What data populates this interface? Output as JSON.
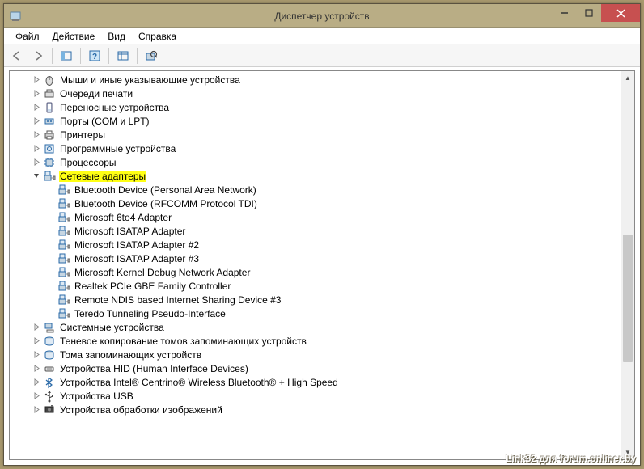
{
  "window": {
    "title": "Диспетчер устройств"
  },
  "menu": {
    "file": "Файл",
    "action": "Действие",
    "view": "Вид",
    "help": "Справка"
  },
  "tree": {
    "items": [
      {
        "indent": 1,
        "exp": "collapsed",
        "icon": "mouse",
        "label": "Мыши и иные указывающие устройства"
      },
      {
        "indent": 1,
        "exp": "collapsed",
        "icon": "printq",
        "label": "Очереди печати"
      },
      {
        "indent": 1,
        "exp": "collapsed",
        "icon": "portable",
        "label": "Переносные устройства"
      },
      {
        "indent": 1,
        "exp": "collapsed",
        "icon": "port",
        "label": "Порты (COM и LPT)"
      },
      {
        "indent": 1,
        "exp": "collapsed",
        "icon": "printer",
        "label": "Принтеры"
      },
      {
        "indent": 1,
        "exp": "collapsed",
        "icon": "software",
        "label": "Программные устройства"
      },
      {
        "indent": 1,
        "exp": "collapsed",
        "icon": "cpu",
        "label": "Процессоры"
      },
      {
        "indent": 1,
        "exp": "expanded",
        "icon": "net",
        "label": "Сетевые адаптеры",
        "highlight": true
      },
      {
        "indent": 2,
        "exp": "none",
        "icon": "net",
        "label": "Bluetooth Device (Personal Area Network)"
      },
      {
        "indent": 2,
        "exp": "none",
        "icon": "net",
        "label": "Bluetooth Device (RFCOMM Protocol TDI)"
      },
      {
        "indent": 2,
        "exp": "none",
        "icon": "net",
        "label": "Microsoft 6to4 Adapter"
      },
      {
        "indent": 2,
        "exp": "none",
        "icon": "net",
        "label": "Microsoft ISATAP Adapter"
      },
      {
        "indent": 2,
        "exp": "none",
        "icon": "net",
        "label": "Microsoft ISATAP Adapter #2"
      },
      {
        "indent": 2,
        "exp": "none",
        "icon": "net",
        "label": "Microsoft ISATAP Adapter #3"
      },
      {
        "indent": 2,
        "exp": "none",
        "icon": "net",
        "label": "Microsoft Kernel Debug Network Adapter"
      },
      {
        "indent": 2,
        "exp": "none",
        "icon": "net",
        "label": "Realtek PCIe GBE Family Controller"
      },
      {
        "indent": 2,
        "exp": "none",
        "icon": "net",
        "label": "Remote NDIS based Internet Sharing Device #3"
      },
      {
        "indent": 2,
        "exp": "none",
        "icon": "net",
        "label": "Teredo Tunneling Pseudo-Interface"
      },
      {
        "indent": 1,
        "exp": "collapsed",
        "icon": "system",
        "label": "Системные устройства"
      },
      {
        "indent": 1,
        "exp": "collapsed",
        "icon": "shadow",
        "label": "Теневое копирование томов запоминающих устройств"
      },
      {
        "indent": 1,
        "exp": "collapsed",
        "icon": "shadow",
        "label": "Тома запоминающих устройств"
      },
      {
        "indent": 1,
        "exp": "collapsed",
        "icon": "hid",
        "label": "Устройства HID (Human Interface Devices)"
      },
      {
        "indent": 1,
        "exp": "collapsed",
        "icon": "bt",
        "label": "Устройства Intel® Centrino® Wireless Bluetooth® + High Speed"
      },
      {
        "indent": 1,
        "exp": "collapsed",
        "icon": "usb",
        "label": "Устройства USB"
      },
      {
        "indent": 1,
        "exp": "collapsed",
        "icon": "image",
        "label": "Устройства обработки изображений"
      }
    ]
  },
  "watermark": "Link32 для forum.onliner.by"
}
